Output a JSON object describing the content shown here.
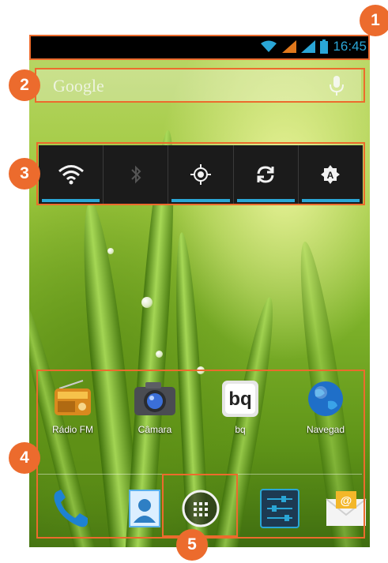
{
  "statusbar": {
    "time": "16:45"
  },
  "searchbar": {
    "logo_text": "Google"
  },
  "widget": {
    "toggles": [
      {
        "name": "wifi",
        "state": "on"
      },
      {
        "name": "bluetooth",
        "state": "off"
      },
      {
        "name": "gps",
        "state": "on"
      },
      {
        "name": "sync",
        "state": "on"
      },
      {
        "name": "brightness-auto",
        "state": "on"
      }
    ]
  },
  "apps": [
    {
      "label": "Rádio FM",
      "icon": "radio-icon"
    },
    {
      "label": "Câmara",
      "icon": "camera-icon"
    },
    {
      "label": "bq",
      "icon": "bq-icon"
    },
    {
      "label": "Navegad",
      "icon": "browser-globe-icon"
    }
  ],
  "dock": [
    {
      "icon": "phone-icon"
    },
    {
      "icon": "contacts-icon"
    },
    {
      "icon": "app-drawer-icon"
    },
    {
      "icon": "settings-icon"
    },
    {
      "icon": "email-icon"
    }
  ],
  "callouts": [
    "1",
    "2",
    "3",
    "4",
    "5"
  ],
  "colors": {
    "callout": "#ec6b2d",
    "accent": "#2aa6d6"
  }
}
